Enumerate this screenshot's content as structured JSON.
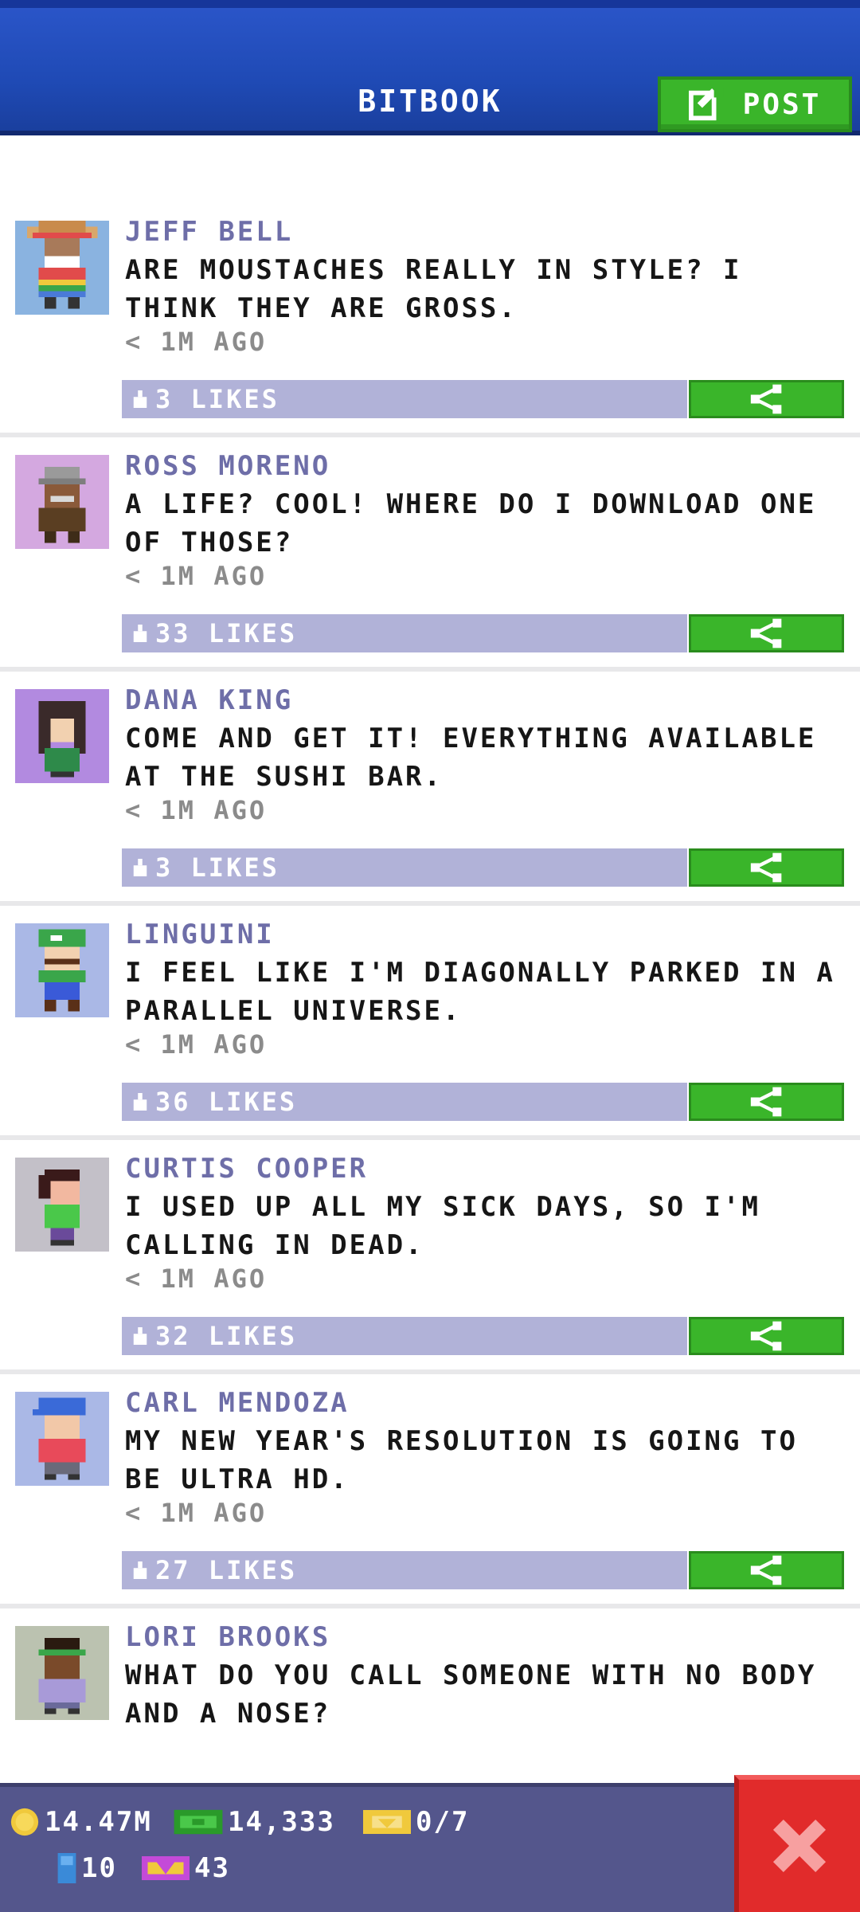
{
  "header": {
    "title": "BITBOOK",
    "post_label": "POST",
    "colors": {
      "bar": "#1f4ab5",
      "button": "#3ab52a"
    }
  },
  "feed": [
    {
      "author": "JEFF BELL",
      "message": "ARE MOUSTACHES REALLY IN STYLE? I THINK THEY ARE GROSS.",
      "time": "< 1M AGO",
      "likes": "3 LIKES",
      "avatar_bg": "#8ab3e0",
      "avatar": "sombrero-man"
    },
    {
      "author": "ROSS MORENO",
      "message": "A LIFE? COOL! WHERE DO I DOWNLOAD ONE OF THOSE?",
      "time": "< 1M AGO",
      "likes": "33 LIKES",
      "avatar_bg": "#d4a8e0",
      "avatar": "gray-hair-man"
    },
    {
      "author": "DANA KING",
      "message": "COME AND GET IT! EVERYTHING AVAILABLE AT THE SUSHI BAR.",
      "time": "< 1M AGO",
      "likes": "3 LIKES",
      "avatar_bg": "#b28ae0",
      "avatar": "dark-hair-woman"
    },
    {
      "author": "LINGUINI",
      "message": "I FEEL LIKE I'M DIAGONALLY PARKED IN A PARALLEL UNIVERSE.",
      "time": "< 1M AGO",
      "likes": "36 LIKES",
      "avatar_bg": "#aab8e6",
      "avatar": "green-cap-plumber"
    },
    {
      "author": "CURTIS COOPER",
      "message": "I USED UP ALL MY SICK DAYS, SO I'M CALLING IN DEAD.",
      "time": "< 1M AGO",
      "likes": "32 LIKES",
      "avatar_bg": "#c3c0c8",
      "avatar": "green-shirt-man"
    },
    {
      "author": "CARL MENDOZA",
      "message": "MY NEW YEAR'S RESOLUTION IS GOING TO BE ULTRA HD.",
      "time": "< 1M AGO",
      "likes": "27 LIKES",
      "avatar_bg": "#aab8e6",
      "avatar": "blue-cap-man"
    },
    {
      "author": "LORI BROOKS",
      "message": "WHAT DO YOU CALL SOMEONE WITH NO BODY AND A NOSE?",
      "time": "",
      "likes": "",
      "avatar_bg": "#bbc2b0",
      "avatar": "green-headband-person"
    }
  ],
  "bottom_bar": {
    "coins": "14.47M",
    "bux": "14,333",
    "tickets": "0/7",
    "bitizens": "10",
    "vip": "43"
  },
  "close_icon": "close-x-icon"
}
